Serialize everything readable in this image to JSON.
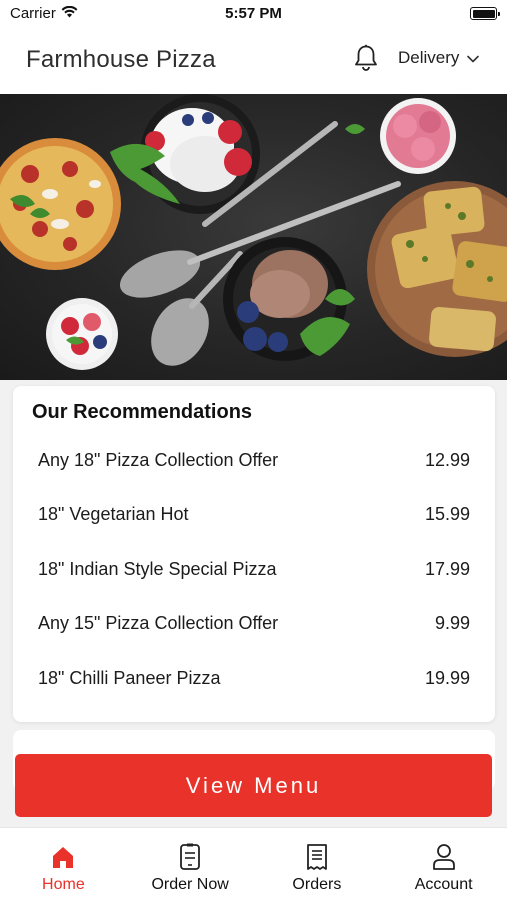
{
  "status_bar": {
    "carrier": "Carrier",
    "time": "5:57 PM"
  },
  "header": {
    "title": "Farmhouse Pizza",
    "bell_icon": "bell-icon",
    "delivery_label": "Delivery"
  },
  "hero": {
    "description_icon": "food-banner-image"
  },
  "recommendations": {
    "title": "Our Recommendations",
    "items": [
      {
        "name": "Any 18\" Pizza Collection Offer",
        "price": "12.99"
      },
      {
        "name": "18\" Vegetarian Hot",
        "price": "15.99"
      },
      {
        "name": "18\" Indian Style Special Pizza",
        "price": "17.99"
      },
      {
        "name": "Any 15\" Pizza Collection Offer",
        "price": "9.99"
      },
      {
        "name": "18\" Chilli Paneer Pizza",
        "price": "19.99"
      }
    ]
  },
  "view_menu_label": "View Menu",
  "nav": {
    "items": [
      {
        "label": "Home",
        "icon": "home-icon",
        "active": true
      },
      {
        "label": "Order Now",
        "icon": "order-icon",
        "active": false
      },
      {
        "label": "Orders",
        "icon": "receipt-icon",
        "active": false
      },
      {
        "label": "Account",
        "icon": "user-icon",
        "active": false
      }
    ]
  },
  "colors": {
    "accent": "#e8322a",
    "background": "#f1f1f1",
    "card": "#ffffff"
  }
}
